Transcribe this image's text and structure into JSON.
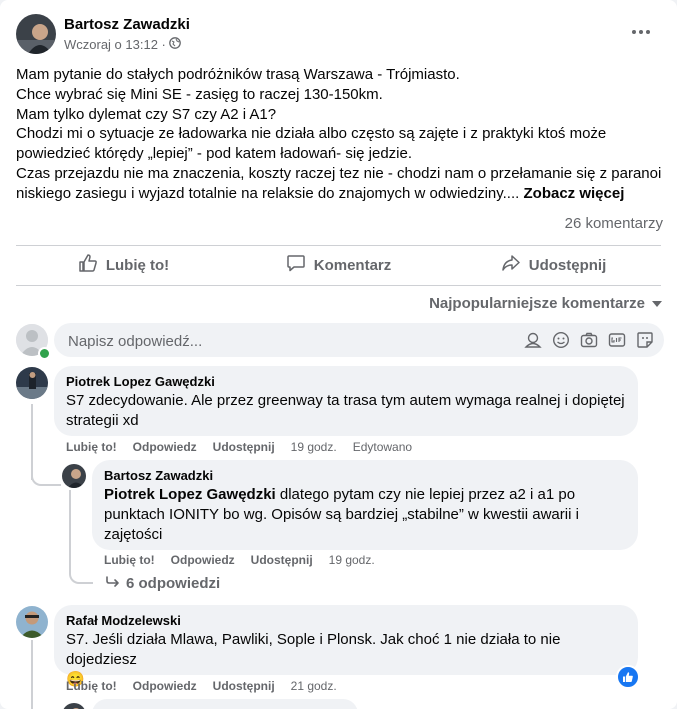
{
  "post": {
    "author": "Bartosz Zawadzki",
    "time": "Wczoraj o 13:12 ·",
    "lines": [
      "Mam pytanie do stałych podróżników trasą Warszawa - Trójmiasto.",
      "Chce wybrać się Mini SE - zasięg to raczej 130-150km.",
      "Mam tylko dylemat czy S7 czy A2 i A1?",
      "Chodzi mi o sytuacje ze ładowarka nie działa albo często są zajęte i z praktyki ktoś może",
      "powiedzieć którędy „lepiej” - pod katem ładowań- się jedzie.",
      "Czas przejazdu nie ma znaczenia, koszty raczej tez nie - chodzi nam o przełamanie się z paranoi",
      "niskiego zasiegu i wyjazd totalnie na relaksie do znajomych w odwiedziny...."
    ],
    "see_more": "Zobacz więcej",
    "comment_count": "26 komentarzy"
  },
  "actions": {
    "like": "Lubię to!",
    "comment": "Komentarz",
    "share": "Udostępnij"
  },
  "sort_label": "Najpopularniejsze komentarze",
  "composer": {
    "placeholder": "Napisz odpowiedź..."
  },
  "comments": [
    {
      "name": "Piotrek Lopez Gawędzki",
      "text_lines": [
        "S7 zdecydowanie. Ale przez greenway ta trasa tym autem wymaga realnej i dopiętej",
        "strategii xd"
      ],
      "like": "Lubię to!",
      "reply": "Odpowiedz",
      "share": "Udostępnij",
      "time": "19 godz.",
      "edited": "Edytowano"
    },
    {
      "name": "Bartosz Zawadzki",
      "mention": "Piotrek Lopez Gawędzki",
      "text_first": " dlatego pytam czy nie lepiej przez a2 i a1 po",
      "text_lines": [
        "punktach IONITY bo wg. Opisów są bardziej „stabilne” w kwestii awarii i",
        "zajętości"
      ],
      "like": "Lubię to!",
      "reply": "Odpowiedz",
      "share": "Udostępnij",
      "time": "19 godz."
    },
    {
      "name": "Rafał Modzelewski",
      "text_lines": [
        "S7. Jeśli działa Mlawa, Pawliki, Sople i Plonsk. Jak choć 1 nie działa to nie dojedziesz"
      ],
      "emoji": "😄",
      "like": "Lubię to!",
      "reply": "Odpowiedz",
      "share": "Udostępnij",
      "time": "21 godz."
    }
  ],
  "replies_link": "6 odpowiedzi",
  "colors": {
    "accent": "#1877f2",
    "muted": "#65676b",
    "bubble": "#f0f2f5",
    "online": "#31a24c"
  }
}
